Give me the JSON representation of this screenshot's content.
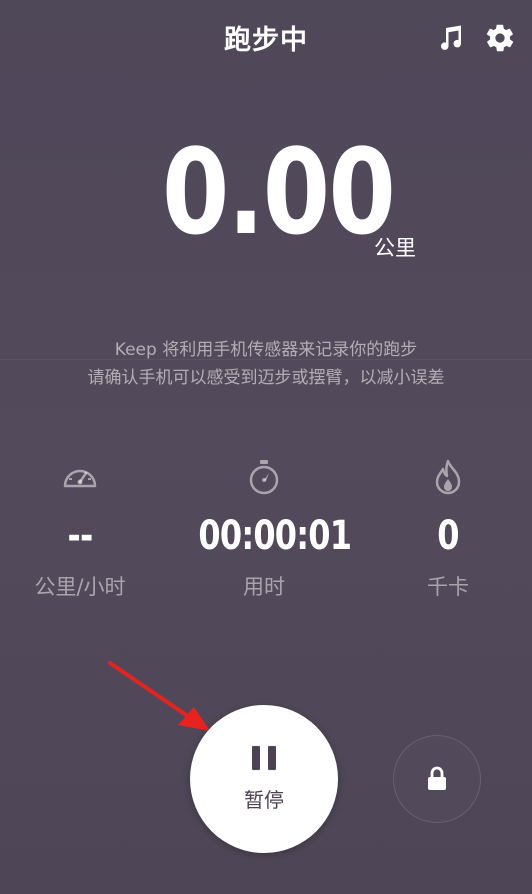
{
  "header": {
    "title": "跑步中",
    "music_icon": "music-note-icon",
    "settings_icon": "gear-icon"
  },
  "distance": {
    "value": "0.00",
    "unit": "公里"
  },
  "notice": {
    "line1": "Keep 将利用手机传感器来记录你的跑步",
    "line2": "请确认手机可以感受到迈步或摆臂，以减小误差"
  },
  "stats": {
    "speed": {
      "icon": "speedometer-icon",
      "value": "--",
      "label": "公里/小时"
    },
    "time": {
      "icon": "stopwatch-icon",
      "value": "00:00:01",
      "label": "用时"
    },
    "calories": {
      "icon": "flame-icon",
      "value": "0",
      "label": "千卡"
    }
  },
  "controls": {
    "pause_label": "暂停",
    "pause_icon": "pause-icon",
    "lock_icon": "lock-icon"
  },
  "colors": {
    "background": "#514959",
    "annotation_arrow": "#e8231f",
    "button_text": "#4b4253"
  }
}
